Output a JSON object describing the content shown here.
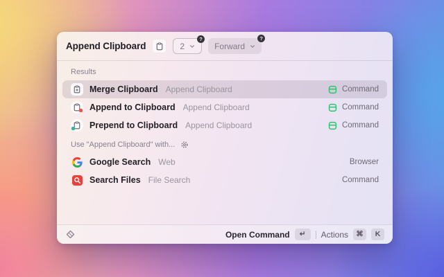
{
  "window": {
    "header": {
      "title": "Append Clipboard",
      "arg_count": {
        "value": "2",
        "help_badge": "?"
      },
      "arg_mode": {
        "value": "Forward",
        "help_badge": "?"
      }
    },
    "results_section": {
      "label": "Results",
      "items": [
        {
          "title": "Merge Clipboard",
          "subtitle": "Append Clipboard",
          "accessory": "Command",
          "selected": true
        },
        {
          "title": "Append to Clipboard",
          "subtitle": "Append Clipboard",
          "accessory": "Command",
          "selected": false
        },
        {
          "title": "Prepend to Clipboard",
          "subtitle": "Append Clipboard",
          "accessory": "Command",
          "selected": false
        }
      ]
    },
    "use_with_section": {
      "label": "Use \"Append Clipboard\" with...",
      "items": [
        {
          "title": "Google Search",
          "subtitle": "Web",
          "accessory": "Browser"
        },
        {
          "title": "Search Files",
          "subtitle": "File Search",
          "accessory": "Command"
        }
      ]
    },
    "footer": {
      "primary_label": "Open Command",
      "primary_key": "↵",
      "actions_label": "Actions",
      "actions_key_1": "⌘",
      "actions_key_2": "K"
    }
  },
  "colors": {
    "command_green": "#2dc26f",
    "search_files_red": "#e8413c",
    "append_dot_red": "#e0564f",
    "prepend_dot_teal": "#2cb9a4",
    "selected_row": "rgba(84,66,90,0.14)"
  }
}
